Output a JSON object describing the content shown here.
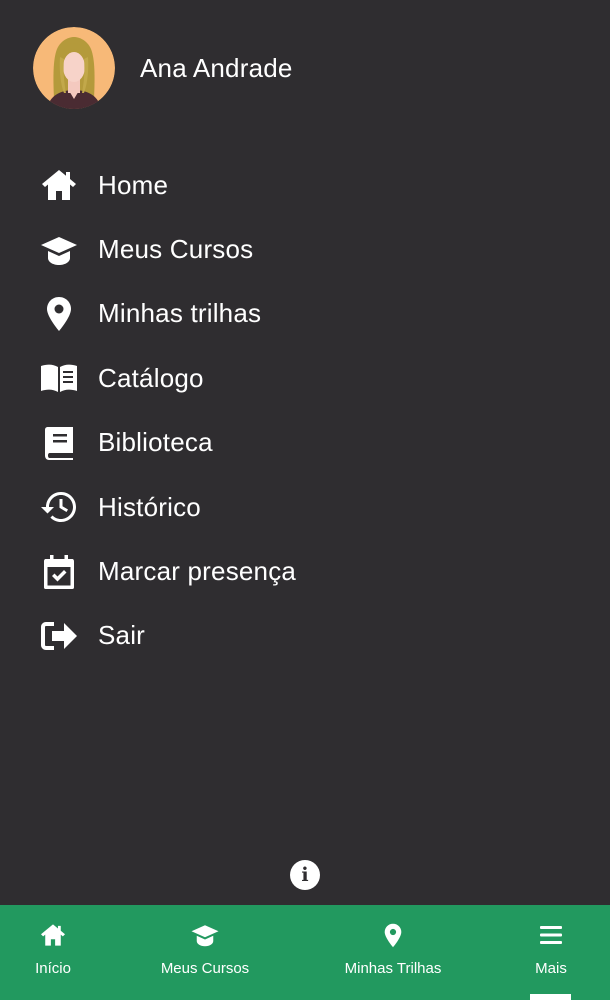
{
  "profile": {
    "name": "Ana Andrade",
    "avatar_icon": "woman-avatar-icon"
  },
  "menu": [
    {
      "label": "Home",
      "icon": "home-icon"
    },
    {
      "label": "Meus Cursos",
      "icon": "graduation-cap-icon"
    },
    {
      "label": "Minhas trilhas",
      "icon": "map-pin-icon"
    },
    {
      "label": "Catálogo",
      "icon": "open-book-icon"
    },
    {
      "label": "Biblioteca",
      "icon": "book-icon"
    },
    {
      "label": "Histórico",
      "icon": "history-icon"
    },
    {
      "label": "Marcar presença",
      "icon": "calendar-check-icon"
    },
    {
      "label": "Sair",
      "icon": "sign-out-icon"
    }
  ],
  "info_button": {
    "icon": "info-icon",
    "glyph": "i"
  },
  "bottom_nav": {
    "items": [
      {
        "label": "Início",
        "icon": "home-icon"
      },
      {
        "label": "Meus Cursos",
        "icon": "graduation-cap-icon"
      },
      {
        "label": "Minhas Trilhas",
        "icon": "map-pin-icon"
      },
      {
        "label": "Mais",
        "icon": "menu-icon"
      }
    ],
    "active": "Mais"
  },
  "colors": {
    "background": "#2f2d30",
    "bottom_nav": "#22995f",
    "text": "#ffffff",
    "avatar_bg": "#f7b978",
    "avatar_hair": "#b49a3b"
  }
}
